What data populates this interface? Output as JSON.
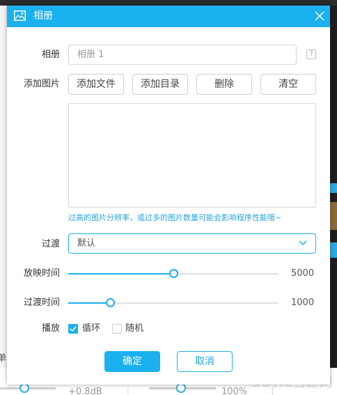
{
  "dialog": {
    "title": "相册",
    "album_label": "相册",
    "album_input_placeholder": "相册 1",
    "help_label": "?",
    "add_images_label": "添加图片",
    "buttons": {
      "add_file": "添加文件",
      "add_folder": "添加目录",
      "delete": "删除",
      "clear": "清空"
    },
    "hint": "过高的图片分辨率，或过多的图片数量可能会影响程序性能哦~",
    "transition_label": "过渡",
    "transition_value": "默认",
    "display_time": {
      "label": "放映时间",
      "value": "5000",
      "fraction": 0.5
    },
    "transition_time": {
      "label": "过渡时间",
      "value": "1000",
      "fraction": 0.2
    },
    "play": {
      "label": "播放",
      "loop_label": "循环",
      "loop_checked": true,
      "random_label": "随机",
      "random_checked": false
    },
    "ok_label": "确定",
    "cancel_label": "取消"
  },
  "background": {
    "left_fragment": "单",
    "gain_text": "+0.8dB",
    "volume_text": "100%",
    "watermark": "3DHE当游网"
  },
  "colors": {
    "accent": "#1bb0ee"
  }
}
